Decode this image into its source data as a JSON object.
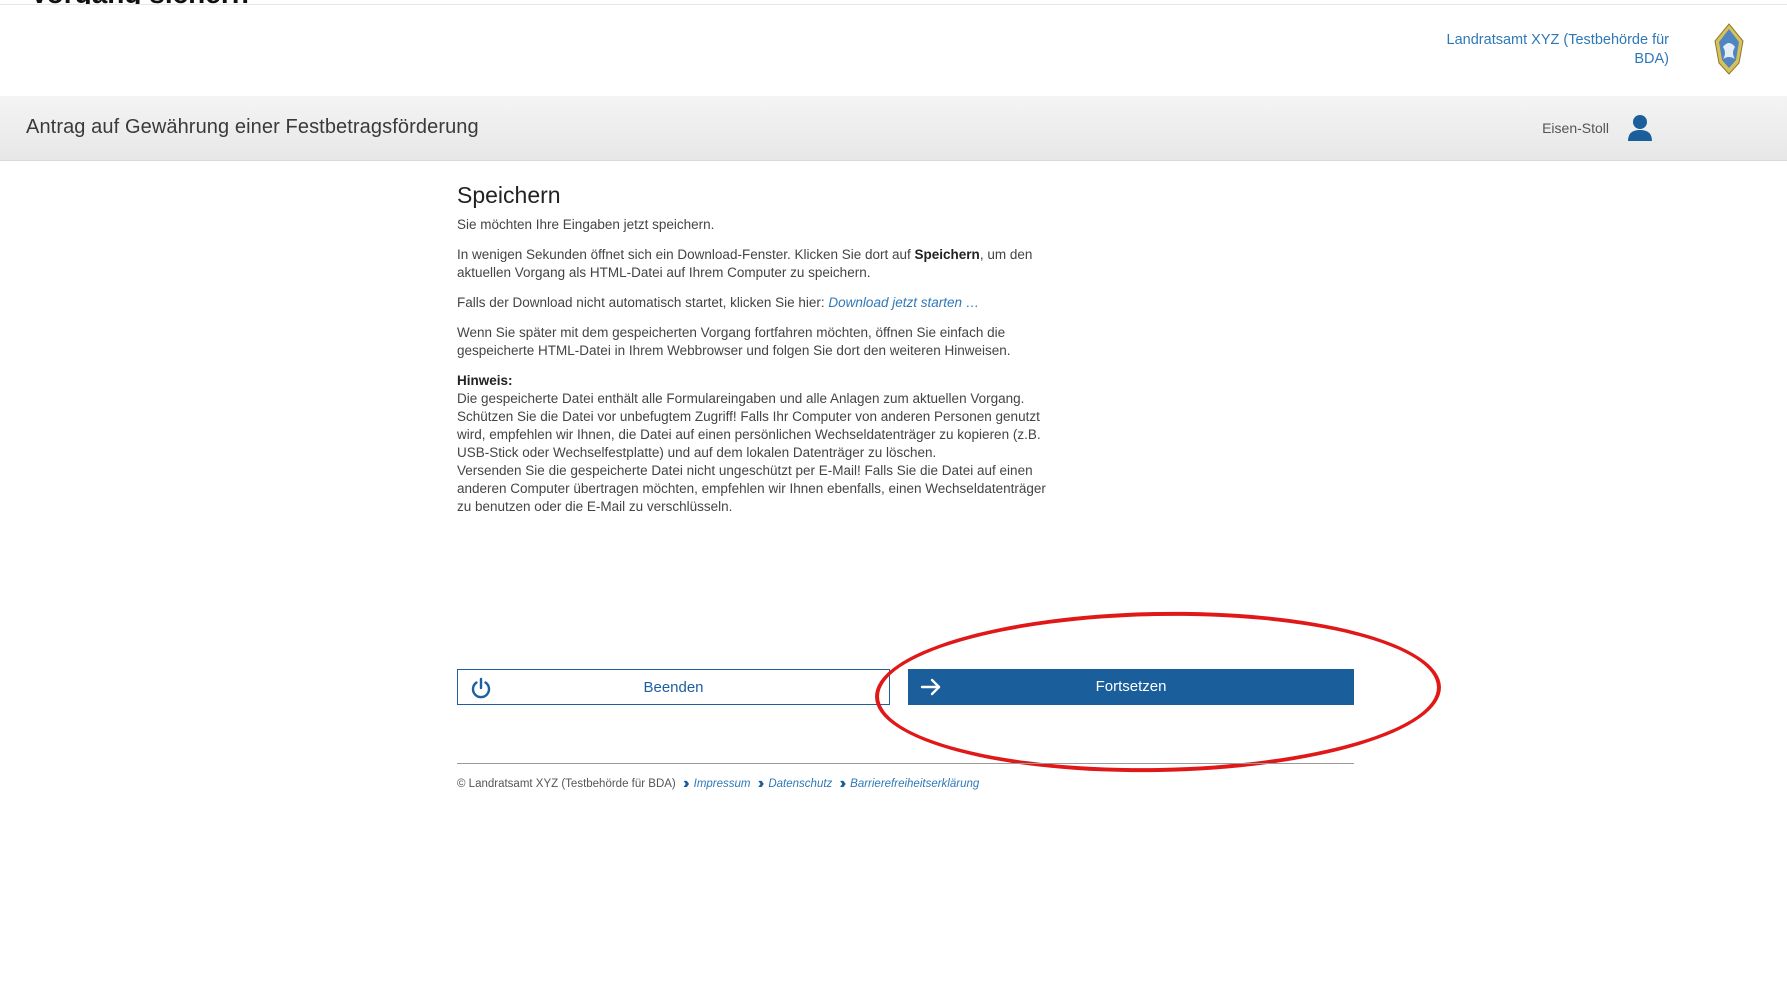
{
  "cropped_caption": "Vorgang sichern \"",
  "header": {
    "authority": "Landratsamt XYZ (Testbehörde für BDA)",
    "crest_icon": "crest-icon"
  },
  "titlebar": {
    "title": "Antrag auf Gewährung einer Festbetragsförderung",
    "user_name": "Eisen-Stoll",
    "user_icon": "user-icon"
  },
  "main": {
    "heading": "Speichern",
    "p1": "Sie möchten Ihre Eingaben jetzt speichern.",
    "p2_before": "In wenigen Sekunden öffnet sich ein Download-Fenster. Klicken Sie dort auf ",
    "p2_strong": "Speichern",
    "p2_after": ", um den aktuellen Vorgang als HTML-Datei auf Ihrem Computer zu speichern.",
    "p3_before": "Falls der Download nicht automatisch startet, klicken Sie hier: ",
    "p3_link": "Download jetzt starten …",
    "p4": "Wenn Sie später mit dem gespeicherten Vorgang fortfahren möchten, öffnen Sie einfach die gespeicherte HTML-Datei in Ihrem Webbrowser und folgen Sie dort den weiteren Hinweisen.",
    "hint_title": "Hinweis:",
    "hint_1": "Die gespeicherte Datei enthält alle Formulareingaben und alle Anlagen zum aktuellen Vorgang. Schützen Sie die Datei vor unbefugtem Zugriff! Falls Ihr Computer von anderen Personen genutzt wird, empfehlen wir Ihnen, die Datei auf einen persönlichen Wechseldatenträger zu kopieren (z.B. USB-Stick oder Wechselfestplatte) und auf dem lokalen Datenträger zu löschen.",
    "hint_2": "Versenden Sie die gespeicherte Datei nicht ungeschützt per E-Mail! Falls Sie die Datei auf einen anderen Computer übertragen möchten, empfehlen wir Ihnen ebenfalls, einen Wechseldatenträger zu benutzen oder die E-Mail zu verschlüsseln."
  },
  "buttons": {
    "end_label": "Beenden",
    "end_icon": "power-icon",
    "next_label": "Fortsetzen",
    "next_icon": "arrow-right-icon"
  },
  "footer": {
    "copyright": "© Landratsamt XYZ (Testbehörde für BDA)",
    "links": [
      "Impressum",
      "Datenschutz",
      "Barrierefreiheitserklärung"
    ]
  },
  "colors": {
    "primary": "#1a5e9c",
    "link": "#2f78b8",
    "annotation": "#e01818"
  }
}
